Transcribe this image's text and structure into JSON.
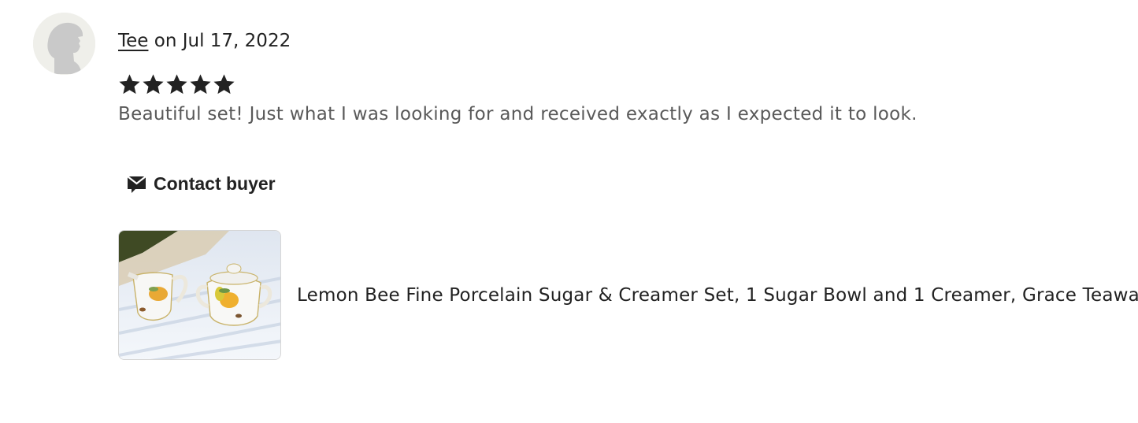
{
  "review": {
    "author": "Tee",
    "date_text": "on Jul 17, 2022",
    "rating": 5,
    "text": "Beautiful set! Just what I was looking for and received exactly as I expected it to look."
  },
  "actions": {
    "contact_label": "Contact buyer",
    "contact_icon": "envelope-icon"
  },
  "product": {
    "title": "Lemon Bee Fine Porcelain Sugar & Creamer Set, 1 Sugar Bowl and 1 Creamer, Grace Teaware"
  },
  "colors": {
    "text": "#222222",
    "muted_text": "#595959",
    "avatar_bg": "#efefea",
    "avatar_fg": "#c8c8c8"
  }
}
